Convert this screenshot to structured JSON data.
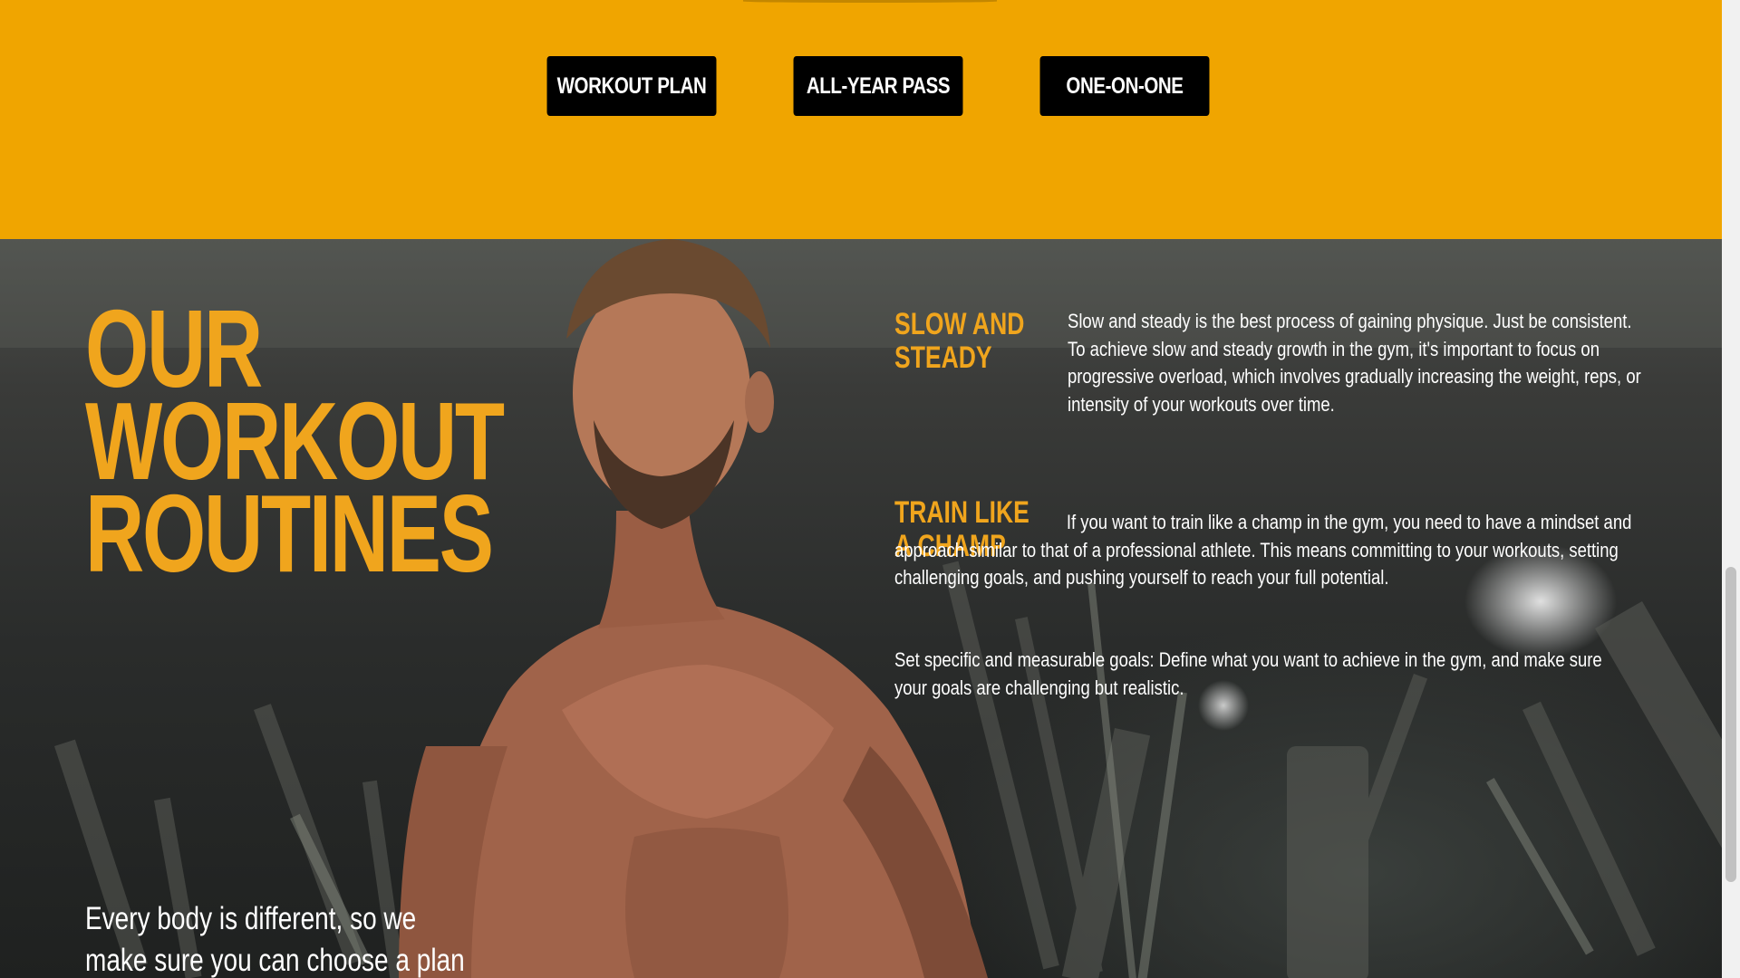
{
  "plans": {
    "buttons": [
      {
        "label": "WORKOUT PLAN"
      },
      {
        "label": "ALL-YEAR PASS"
      },
      {
        "label": "ONE-ON-ONE"
      }
    ]
  },
  "hero": {
    "heading_lines": [
      "OUR",
      "WORKOUT",
      "ROUTINES"
    ],
    "sections": [
      {
        "title": "SLOW AND STEADY",
        "text": "Slow and steady is the best process of gaining physique. Just be consistent. To achieve slow and steady growth in the gym, it's important to focus on progressive overload, which involves gradually increasing the weight, reps, or intensity of your workouts over time."
      },
      {
        "title": "TRAIN LIKE A CHAMP",
        "text": "If you want to train like a champ in the gym, you need to have a mindset and approach similar to that of a professional athlete. This means committing to your workouts, setting challenging goals, and pushing yourself to reach your full potential.",
        "text_2": "Set specific and measurable goals: Define what you want to achieve in the gym, and make sure your goals are challenging but realistic."
      }
    ],
    "lead": "Every body is different, so we make sure you can choose a plan"
  },
  "colors": {
    "band": "#f0a500",
    "accent": "#f0a51d",
    "button_bg": "#000000",
    "button_text": "#ffffff"
  }
}
